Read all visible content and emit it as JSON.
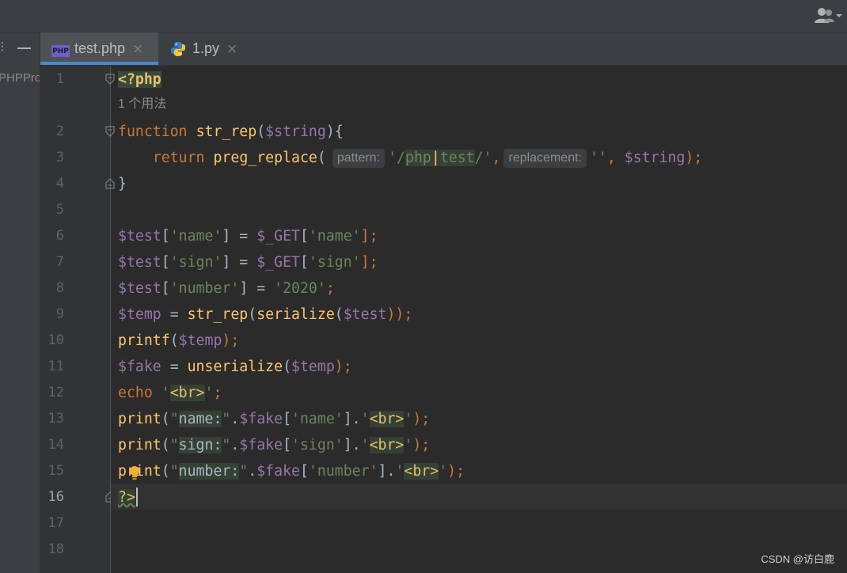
{
  "window": {
    "user_icon": "user-icon"
  },
  "project_panel": {
    "label": "PHPPro"
  },
  "tabs": [
    {
      "label": "test.php",
      "icon": "php-file-icon",
      "active": true
    },
    {
      "label": "1.py",
      "icon": "python-file-icon",
      "active": false
    }
  ],
  "tab_close_glyph": "×",
  "line_numbers": [
    "1",
    "2",
    "3",
    "4",
    "5",
    "6",
    "7",
    "8",
    "9",
    "10",
    "11",
    "12",
    "13",
    "14",
    "15",
    "16",
    "17",
    "18"
  ],
  "current_line": "16",
  "usage_hint": "1 个用法",
  "inlay_hints": {
    "pattern": "pattern:",
    "replacement": "replacement:"
  },
  "code": {
    "l1": "<?php",
    "l2": {
      "kw": "function",
      "name": "str_rep",
      "open": "(",
      "param": "$string",
      "close": "){"
    },
    "l3": {
      "kw": "return",
      "fn": "preg_replace",
      "open": "(",
      "q1": "'/",
      "a": "php",
      "bar": "|",
      "b": "test",
      "q2": "/'",
      "comma1": ",",
      "empty": "''",
      "comma2": ",",
      "var": "$string",
      "close": ");"
    },
    "l4": "}",
    "l6": {
      "var": "$test",
      "key": "'name'",
      "eq": "] = ",
      "get": "$_GET",
      "semi": "];"
    },
    "l7": {
      "var": "$test",
      "key": "'sign'",
      "eq": "] = ",
      "get": "$_GET",
      "semi": "];"
    },
    "l8": {
      "var": "$test",
      "key": "'number'",
      "eq": "] = ",
      "val": "'2020'",
      "semi": ";"
    },
    "l9": {
      "var": "$temp",
      "eq": " = ",
      "fn1": "str_rep",
      "fn2": "serialize",
      "arg": "$test",
      "close": "));"
    },
    "l10": {
      "fn": "printf",
      "arg": "$temp",
      "close": ");"
    },
    "l11": {
      "var": "$fake",
      "eq": " = ",
      "fn": "unserialize",
      "arg": "$temp",
      "close": ");"
    },
    "l12": {
      "kw": "echo",
      "br": "<br>",
      "semi": ";"
    },
    "l13": {
      "fn": "print",
      "label": "name:",
      "var": "$fake",
      "key": "'name'",
      "br": "<br>"
    },
    "l14": {
      "fn": "print",
      "label": "sign:",
      "var": "$fake",
      "key": "'sign'",
      "br": "<br>"
    },
    "l15": {
      "fn": "print",
      "label": "number:",
      "var": "$fake",
      "key": "'number'",
      "br": "<br>"
    },
    "l16": "?>"
  },
  "watermark": "CSDN @访白鹿",
  "colors": {
    "editor_bg": "#2b2b2b",
    "keyword": "#cc7832",
    "function": "#ffc66d",
    "variable": "#9876aa",
    "string": "#6a8759",
    "tab_underline": "#4a88c7"
  }
}
